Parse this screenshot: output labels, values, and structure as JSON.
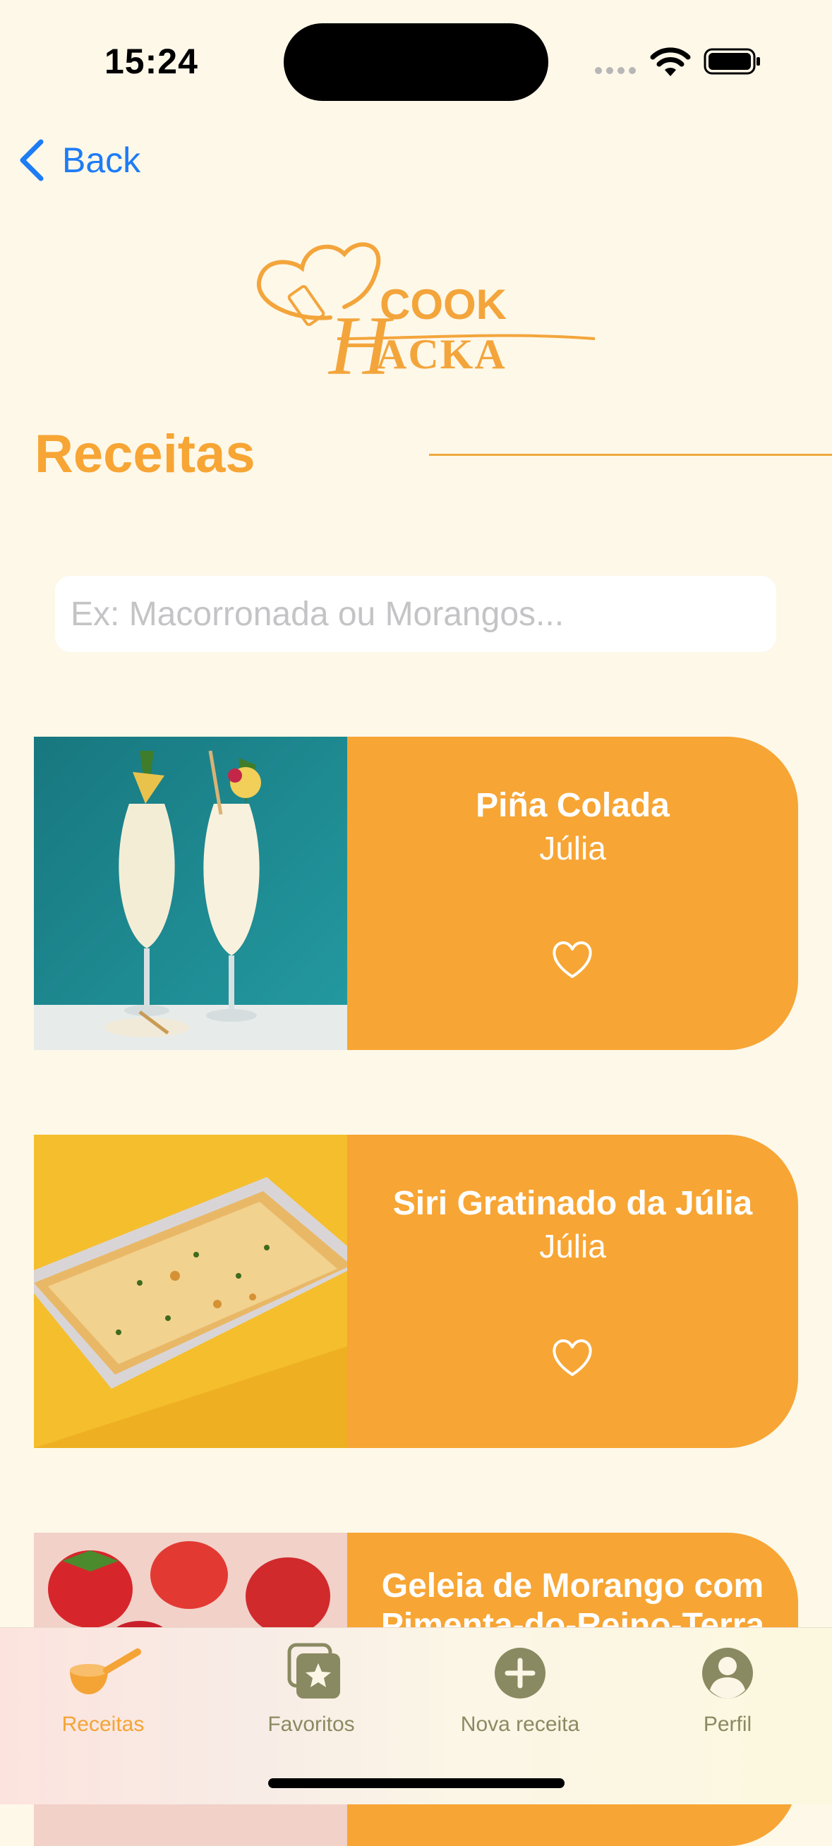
{
  "status": {
    "time": "15:24"
  },
  "nav": {
    "back_label": "Back"
  },
  "logo": {
    "line1": "COOK",
    "line2": "ACKA",
    "initial": "H"
  },
  "page": {
    "title": "Receitas"
  },
  "search": {
    "placeholder": "Ex: Macorronada ou Morangos...",
    "value": ""
  },
  "recipes": [
    {
      "name": "Piña Colada",
      "author": "Júlia",
      "image": "pina-colada-photo",
      "favorite": false
    },
    {
      "name": "Siri Gratinado da Júlia",
      "author": "Júlia",
      "image": "siri-gratinado-photo",
      "favorite": false
    },
    {
      "name": "Geleia de Morango com Pimenta-do-Reino-Terra",
      "author": "",
      "image": "strawberry-photo",
      "favorite": false
    }
  ],
  "tabs": [
    {
      "label": "Receitas",
      "icon": "frying-pan-icon",
      "active": true
    },
    {
      "label": "Favoritos",
      "icon": "favorites-stack-icon",
      "active": false
    },
    {
      "label": "Nova receita",
      "icon": "plus-circle-icon",
      "active": false
    },
    {
      "label": "Perfil",
      "icon": "person-circle-icon",
      "active": false
    }
  ],
  "colors": {
    "accent": "#F7A534",
    "background": "#FEF8E9",
    "link": "#1E7CF5",
    "inactive_tab": "#8A8A62"
  }
}
